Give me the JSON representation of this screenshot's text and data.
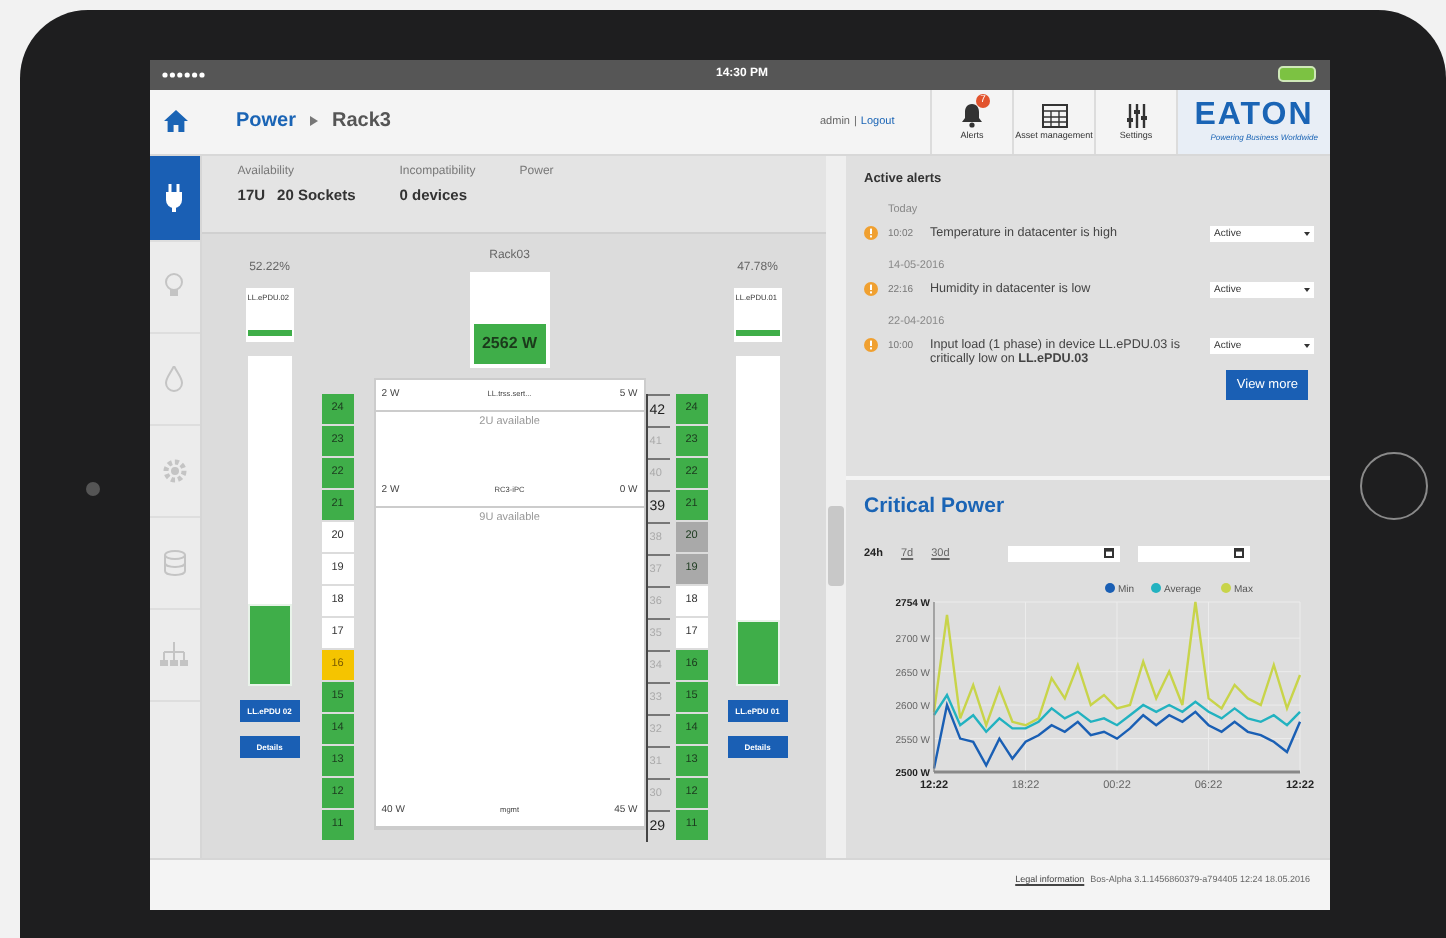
{
  "status_bar": {
    "time": "14:30 PM"
  },
  "header": {
    "breadcrumb": [
      {
        "label": "Power",
        "link": true
      },
      {
        "label": "Rack3",
        "link": false
      }
    ],
    "user": "admin",
    "separator": "|",
    "logout": "Logout",
    "tools": [
      {
        "kind": "bell",
        "label": "Alerts",
        "badge": "7"
      },
      {
        "kind": "grid",
        "label": "Asset management"
      },
      {
        "kind": "sliders",
        "label": "Settings"
      }
    ],
    "logo": {
      "brand": "EATON",
      "tagline": "Powering Business Worldwide"
    }
  },
  "sidebar": {
    "items": [
      {
        "kind": "plug",
        "selected": true
      },
      {
        "kind": "bulb",
        "selected": false
      },
      {
        "kind": "drop",
        "selected": false
      },
      {
        "kind": "gear",
        "selected": false
      },
      {
        "kind": "database",
        "selected": false
      },
      {
        "kind": "network",
        "selected": false
      }
    ]
  },
  "summary": [
    {
      "label": "Availability",
      "values": [
        "17U",
        "20 Sockets"
      ]
    },
    {
      "label": "Incompatibility",
      "values": [
        "0 devices"
      ]
    },
    {
      "label": "Power"
    }
  ],
  "rack": {
    "title": "Rack03",
    "power": "2562 W",
    "pdus": [
      {
        "percent": "52.22%",
        "name": "LL.ePDU.02",
        "level": 0.25,
        "button": "LL.ePDU 02",
        "details": "Details"
      },
      {
        "percent": "47.78%",
        "name": "LL.ePDU.01",
        "level": 0.2,
        "button": "LL.ePDU 01",
        "details": "Details"
      }
    ],
    "units_left": [
      {
        "number": "24",
        "color": "#3fae49"
      },
      {
        "number": "23",
        "color": "#3fae49"
      },
      {
        "number": "22",
        "color": "#3fae49"
      },
      {
        "number": "21",
        "color": "#3fae49"
      },
      {
        "number": "20",
        "color": "#ffffff"
      },
      {
        "number": "19",
        "color": "#ffffff"
      },
      {
        "number": "18",
        "color": "#ffffff"
      },
      {
        "number": "17",
        "color": "#ffffff"
      },
      {
        "number": "16",
        "color": "#f5c400"
      },
      {
        "number": "15",
        "color": "#3fae49"
      },
      {
        "number": "14",
        "color": "#3fae49"
      },
      {
        "number": "13",
        "color": "#3fae49"
      },
      {
        "number": "12",
        "color": "#3fae49"
      },
      {
        "number": "11",
        "color": "#3fae49"
      }
    ],
    "units_right": [
      {
        "number": "24",
        "color": "#3fae49"
      },
      {
        "number": "23",
        "color": "#3fae49"
      },
      {
        "number": "22",
        "color": "#3fae49"
      },
      {
        "number": "21",
        "color": "#3fae49"
      },
      {
        "number": "20",
        "color": "#a9a9a9"
      },
      {
        "number": "19",
        "color": "#a9a9a9"
      },
      {
        "number": "18",
        "color": "#ffffff"
      },
      {
        "number": "17",
        "color": "#ffffff"
      },
      {
        "number": "16",
        "color": "#3fae49"
      },
      {
        "number": "15",
        "color": "#3fae49"
      },
      {
        "number": "14",
        "color": "#3fae49"
      },
      {
        "number": "13",
        "color": "#3fae49"
      },
      {
        "number": "12",
        "color": "#3fae49"
      },
      {
        "number": "11",
        "color": "#3fae49"
      }
    ],
    "ruler": [
      {
        "number": "42",
        "bold": true
      },
      {
        "number": "41",
        "bold": false
      },
      {
        "number": "40",
        "bold": false
      },
      {
        "number": "39",
        "bold": true
      },
      {
        "number": "38",
        "bold": false
      },
      {
        "number": "37",
        "bold": false
      },
      {
        "number": "36",
        "bold": false
      },
      {
        "number": "35",
        "bold": false
      },
      {
        "number": "34",
        "bold": false
      },
      {
        "number": "33",
        "bold": false
      },
      {
        "number": "32",
        "bold": false
      },
      {
        "number": "31",
        "bold": false
      },
      {
        "number": "30",
        "bold": false
      },
      {
        "number": "29",
        "bold": true
      }
    ],
    "slots": [
      {
        "kind": "device",
        "left": "2 W",
        "name": "LL.trss.sert...",
        "right": "5 W"
      },
      {
        "kind": "free",
        "label": "2U available"
      },
      {
        "kind": "empty"
      },
      {
        "kind": "device",
        "left": "2 W",
        "name": "RC3-iPC",
        "right": "0 W"
      },
      {
        "kind": "free",
        "label": "9U available"
      },
      {
        "kind": "empty"
      },
      {
        "kind": "empty"
      },
      {
        "kind": "empty"
      },
      {
        "kind": "empty"
      },
      {
        "kind": "empty"
      },
      {
        "kind": "empty"
      },
      {
        "kind": "empty"
      },
      {
        "kind": "empty"
      },
      {
        "kind": "device",
        "left": "40 W",
        "name": "mgmt",
        "right": "45 W"
      }
    ]
  },
  "alerts": {
    "title": "Active alerts",
    "groups": [
      {
        "date": "Today",
        "items": [
          {
            "time": "10:02",
            "text": "Temperature in datacenter is high",
            "status": "Active"
          }
        ]
      },
      {
        "date": "14-05-2016",
        "items": [
          {
            "time": "22:16",
            "text": "Humidity in datacenter is low",
            "status": "Active"
          }
        ]
      },
      {
        "date": "22-04-2016",
        "items": [
          {
            "time": "10:00",
            "text": "Input load (1 phase) in device LL.ePDU.03 is critically low on **LL.ePDU.03**",
            "status": "Active"
          }
        ]
      }
    ],
    "view_more": "View more"
  },
  "critical_power": {
    "title": "Critical Power",
    "ranges": [
      {
        "label": "24h",
        "selected": true
      },
      {
        "label": "7d",
        "selected": false
      },
      {
        "label": "30d",
        "selected": false
      }
    ],
    "date_fields": [
      {
        "kind": "date"
      },
      {
        "kind": "date"
      }
    ],
    "chart_data": {
      "type": "line",
      "categories": [
        "12:22",
        null,
        null,
        null,
        null,
        null,
        null,
        "18:22",
        null,
        null,
        null,
        null,
        null,
        null,
        "00:22",
        null,
        null,
        null,
        null,
        null,
        null,
        "06:22",
        null,
        null,
        null,
        null,
        null,
        null,
        "12:22"
      ],
      "series": [
        {
          "name": "Min",
          "color": "#1a5fb4",
          "values": [
            2505,
            2600,
            2550,
            2545,
            2510,
            2550,
            2520,
            2545,
            2555,
            2570,
            2560,
            2575,
            2555,
            2560,
            2550,
            2565,
            2585,
            2570,
            2585,
            2575,
            2590,
            2570,
            2560,
            2575,
            2560,
            2555,
            2545,
            2530,
            2575
          ]
        },
        {
          "name": "Average",
          "color": "#22b2c0",
          "values": [
            2585,
            2615,
            2570,
            2585,
            2560,
            2580,
            2565,
            2565,
            2575,
            2595,
            2580,
            2590,
            2575,
            2580,
            2570,
            2585,
            2600,
            2590,
            2600,
            2590,
            2605,
            2590,
            2580,
            2595,
            2580,
            2575,
            2585,
            2570,
            2590
          ]
        },
        {
          "name": "Max",
          "color": "#c8d44a",
          "values": [
            2590,
            2735,
            2580,
            2630,
            2570,
            2625,
            2575,
            2570,
            2580,
            2640,
            2610,
            2660,
            2600,
            2615,
            2595,
            2600,
            2665,
            2610,
            2650,
            2600,
            2754,
            2610,
            2595,
            2630,
            2610,
            2600,
            2660,
            2595,
            2645
          ]
        }
      ],
      "grid": true,
      "legend": true,
      "ylim": [
        2500,
        2754
      ],
      "yticks": [
        {
          "value": 2500,
          "label": "2500 W"
        },
        {
          "value": 2550,
          "label": "2550 W"
        },
        {
          "value": 2600,
          "label": "2600 W"
        },
        {
          "value": 2650,
          "label": "2650 W"
        },
        {
          "value": 2700,
          "label": "2700 W"
        },
        {
          "value": 2754,
          "label": "2754 W"
        }
      ]
    }
  },
  "footer": {
    "link": "Legal information",
    "text": "Bos-Alpha 3.1.1456860379-a794405 12:24 18.05.2016"
  }
}
